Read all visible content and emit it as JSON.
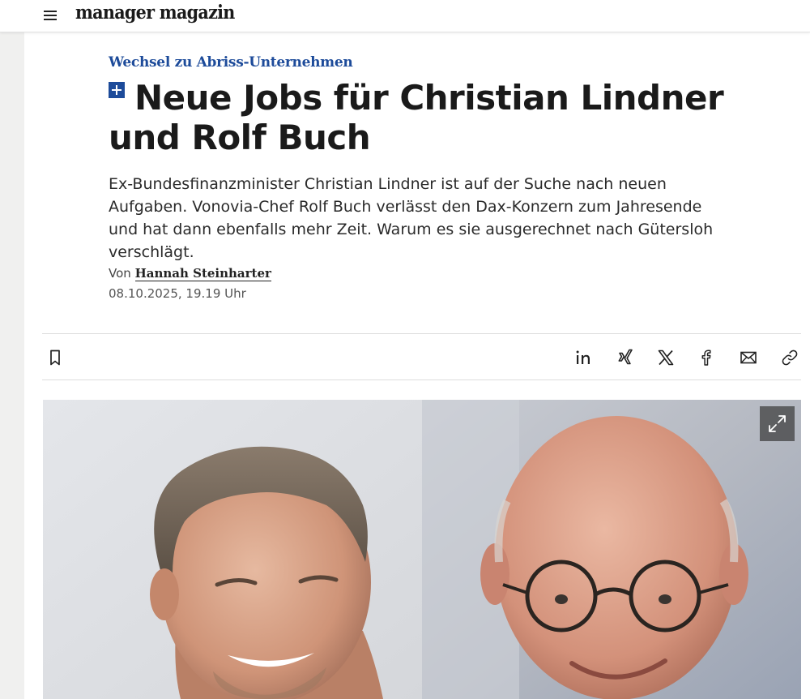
{
  "header": {
    "logo_text": "manager magazin"
  },
  "article": {
    "kicker": "Wechsel zu Abriss-Unternehmen",
    "headline": "Neue Jobs für Christian Lindner und Rolf Buch",
    "teaser": "Ex-Bundesfinanzminister Christian Lindner ist auf der Suche nach neuen Aufgaben. Vonovia-Chef Rolf Buch verlässt den Dax-Konzern zum Jahresende und hat dann ebenfalls mehr Zeit. Warum es sie ausgerechnet nach Gütersloh verschlägt.",
    "byline_prefix": "Von",
    "author": "Hannah Steinharter",
    "date": "08.10.2025, 19.19 Uhr"
  },
  "share_bar": {
    "icons": [
      "bookmark-icon",
      "linkedin-icon",
      "xing-icon",
      "x-icon",
      "facebook-icon",
      "email-icon",
      "link-icon"
    ]
  },
  "hero": {
    "icons": [
      "expand-icon"
    ]
  },
  "colors": {
    "accent": "#1d4b9a",
    "text": "#1a1a1a"
  }
}
